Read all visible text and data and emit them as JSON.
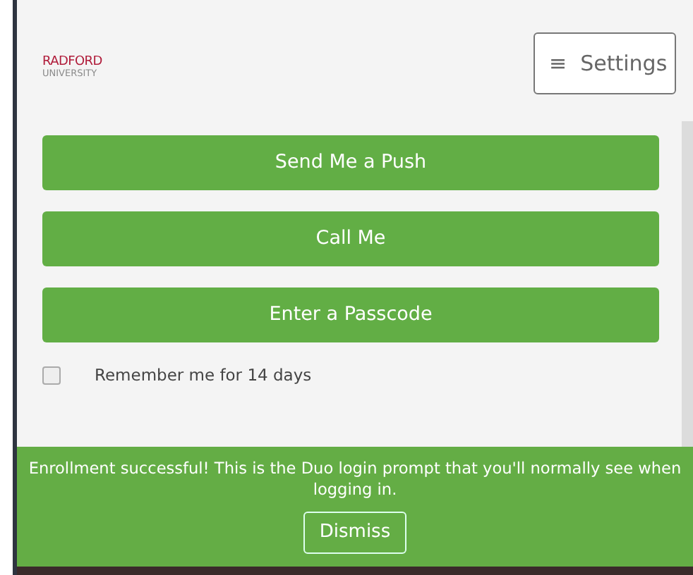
{
  "logo": {
    "name": "RADFORD",
    "subtitle": "UNIVERSITY"
  },
  "settings_button": {
    "icon": "≡",
    "label": "Settings"
  },
  "auth_buttons": [
    {
      "label": "Send Me a Push"
    },
    {
      "label": "Call Me"
    },
    {
      "label": "Enter a Passcode"
    }
  ],
  "remember": {
    "label": "Remember me for 14 days",
    "checked": false
  },
  "banner": {
    "message": "Enrollment successful! This is the Duo login prompt that you'll normally see when logging in.",
    "button": "Dismiss"
  }
}
